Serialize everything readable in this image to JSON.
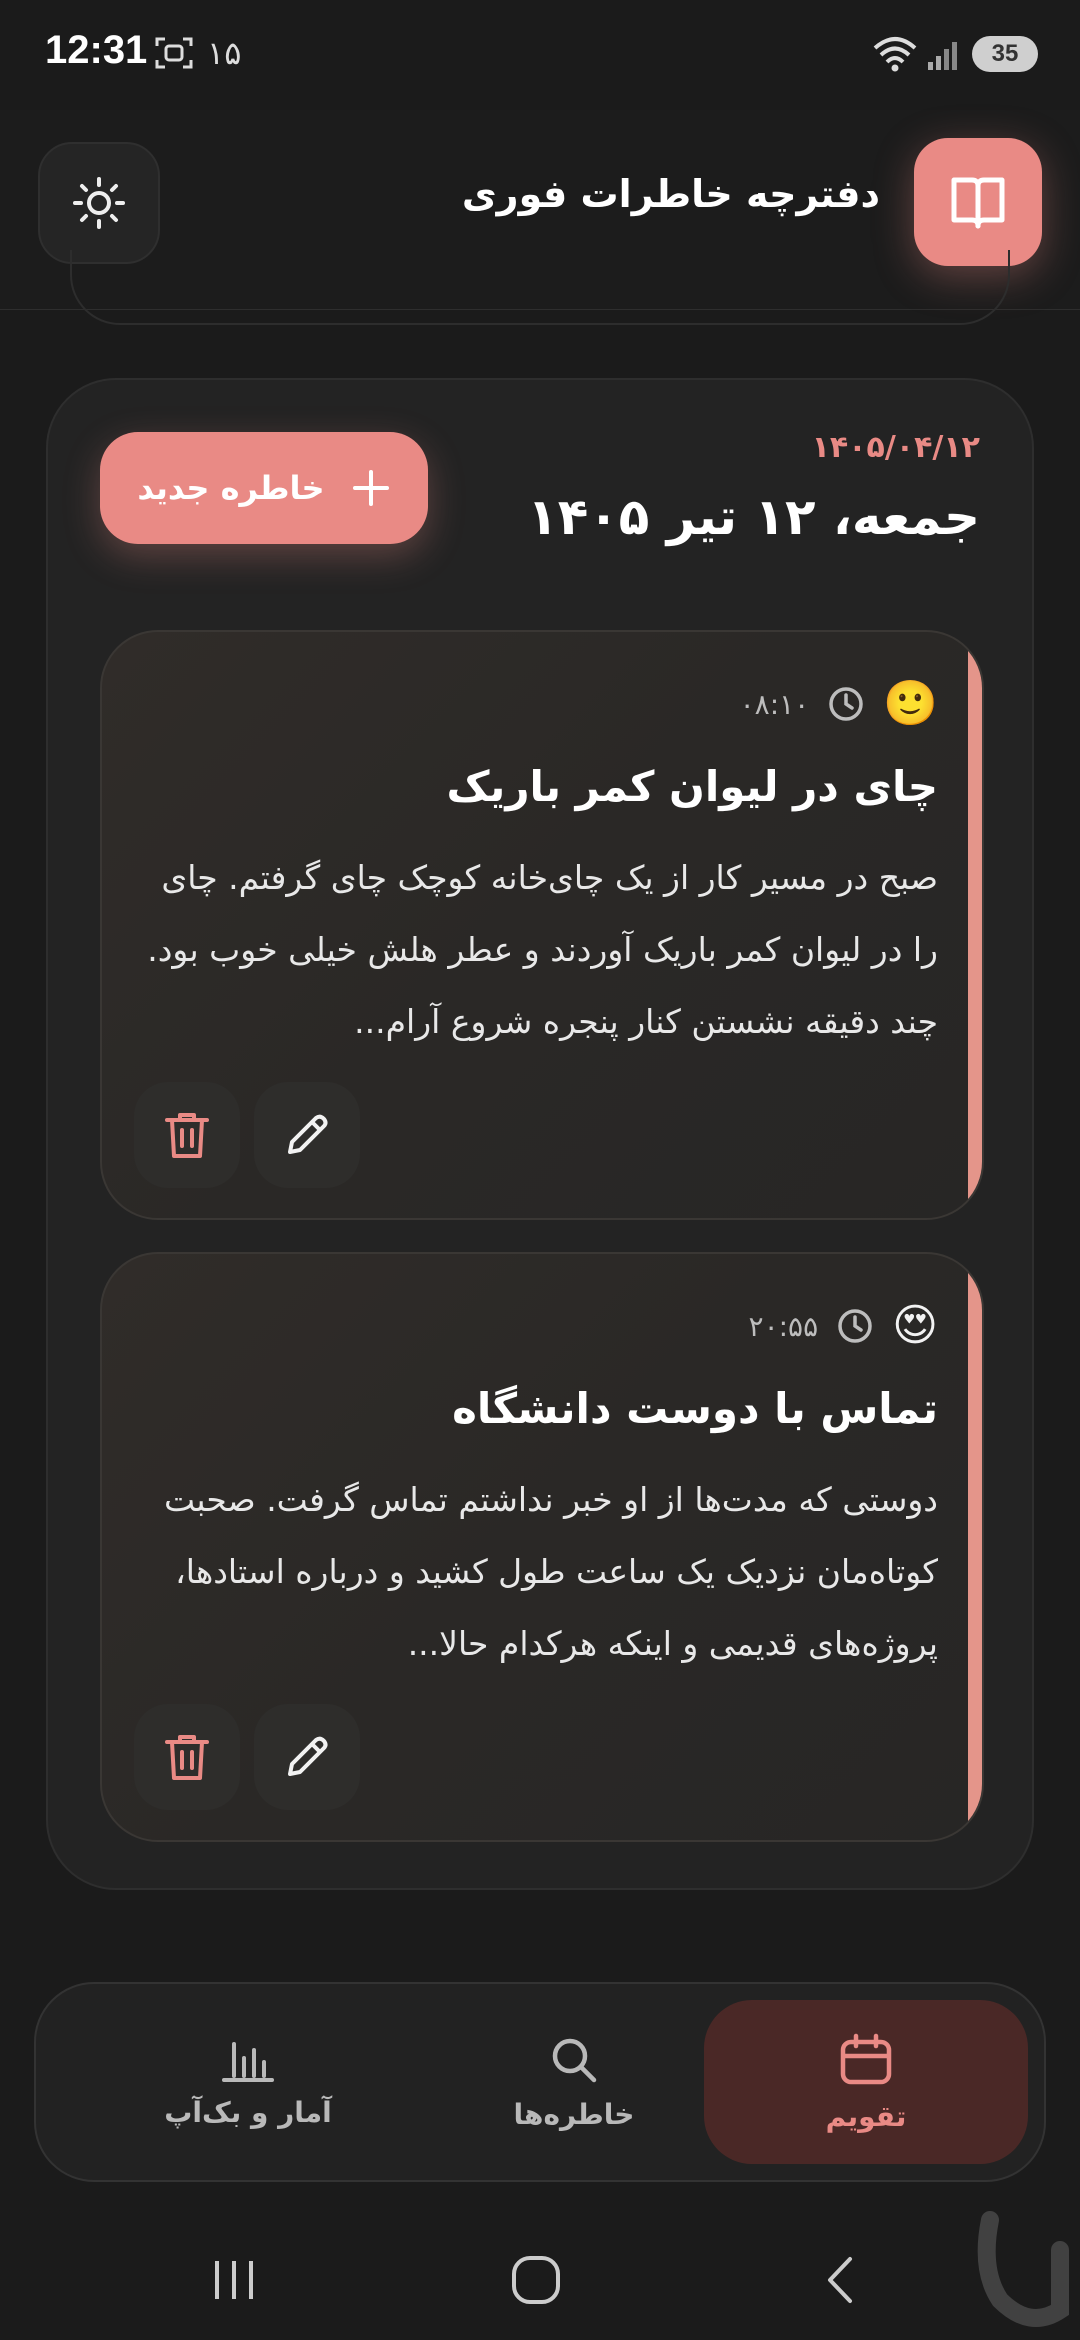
{
  "status_bar": {
    "time": "12:31",
    "notification_count": "۱۵",
    "battery": "35"
  },
  "header": {
    "app_title": "دفترچه خاطرات فوری"
  },
  "day": {
    "date_numeric": "۱۴۰۵/۰۴/۱۲",
    "date_long": "جمعه، ۱۲ تیر ۱۴۰۵",
    "new_memory_label": "خاطره جدید"
  },
  "memories": [
    {
      "emoji": "🙂",
      "time": "۰۸:۱۰",
      "title": "چای در لیوان کمر باریک",
      "body": "صبح در مسیر کار از یک چای‌خانه کوچک چای گرفتم. چای را در لیوان کمر باریک آوردند و عطر هلش خیلی خوب بود. چند دقیقه نشستن کنار پنجره شروع آرام..."
    },
    {
      "emoji": "😍",
      "time": "۲۰:۵۵",
      "title": "تماس با دوست دانشگاه",
      "body": "دوستی که مدت‌ها از او خبر نداشتم تماس گرفت. صحبت کوتاه‌مان نزدیک یک ساعت طول کشید و درباره استادها، پروژه‌های قدیمی و اینکه هرکدام حالا..."
    }
  ],
  "bottom_nav": {
    "items": [
      {
        "label": "آمار و بک‌آپ",
        "icon": "chart-icon",
        "active": false
      },
      {
        "label": "خاطره‌ها",
        "icon": "search-icon",
        "active": false
      },
      {
        "label": "تقویم",
        "icon": "calendar-icon",
        "active": true
      }
    ]
  },
  "colors": {
    "accent": "#e98a85",
    "background": "#1b1b1b",
    "card": "#2a2826",
    "active_nav_bg": "#4a2826"
  }
}
